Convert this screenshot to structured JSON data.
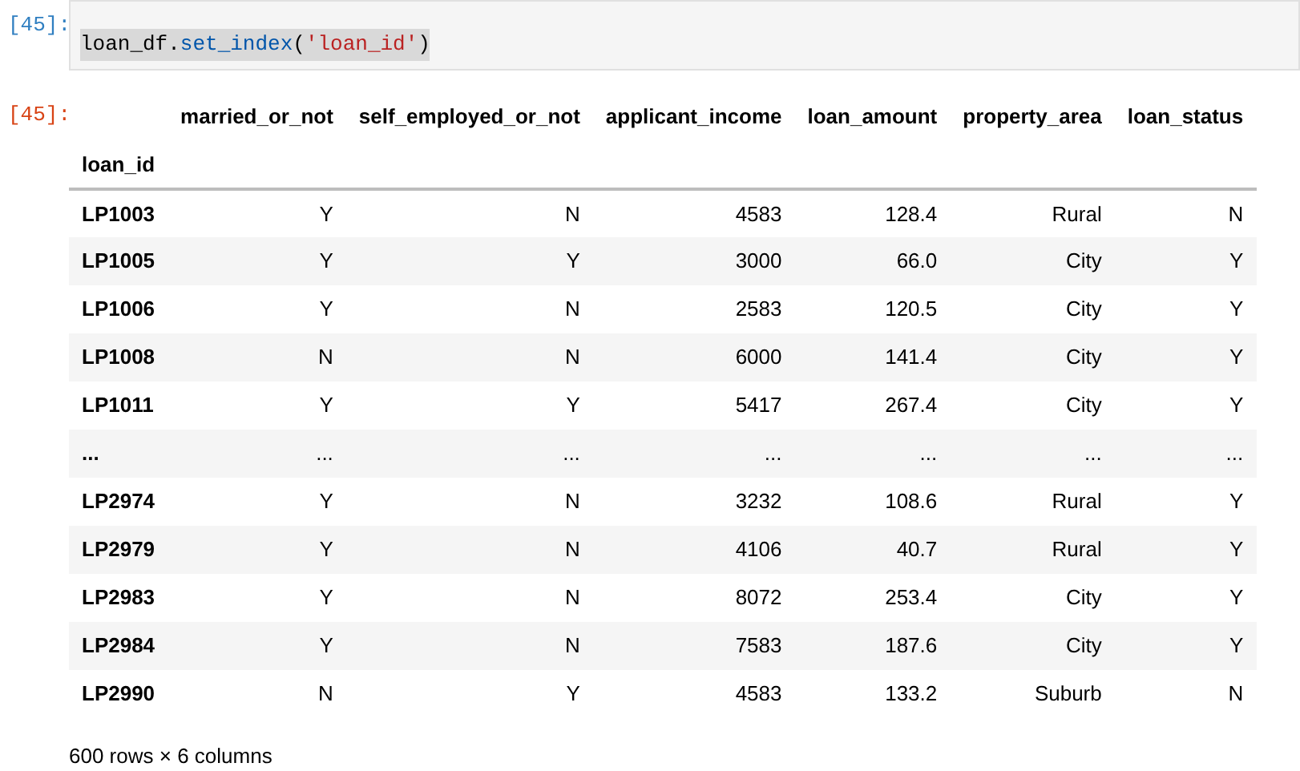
{
  "input_cell": {
    "prompt": "[45]:",
    "code": [
      {
        "kind": "name",
        "text": "loan_df"
      },
      {
        "kind": "punct",
        "text": "."
      },
      {
        "kind": "method",
        "text": "set_index"
      },
      {
        "kind": "punct",
        "text": "("
      },
      {
        "kind": "string",
        "text": "'loan_id'"
      },
      {
        "kind": "punct",
        "text": ")"
      }
    ]
  },
  "output_cell": {
    "prompt": "[45]:",
    "table": {
      "index_name": "loan_id",
      "columns": [
        "married_or_not",
        "self_employed_or_not",
        "applicant_income",
        "loan_amount",
        "property_area",
        "loan_status"
      ],
      "rows": [
        {
          "index": "LP1003",
          "cells": [
            "Y",
            "N",
            "4583",
            "128.4",
            "Rural",
            "N"
          ]
        },
        {
          "index": "LP1005",
          "cells": [
            "Y",
            "Y",
            "3000",
            "66.0",
            "City",
            "Y"
          ]
        },
        {
          "index": "LP1006",
          "cells": [
            "Y",
            "N",
            "2583",
            "120.5",
            "City",
            "Y"
          ]
        },
        {
          "index": "LP1008",
          "cells": [
            "N",
            "N",
            "6000",
            "141.4",
            "City",
            "Y"
          ]
        },
        {
          "index": "LP1011",
          "cells": [
            "Y",
            "Y",
            "5417",
            "267.4",
            "City",
            "Y"
          ]
        },
        {
          "index": "...",
          "cells": [
            "...",
            "...",
            "...",
            "...",
            "...",
            "..."
          ]
        },
        {
          "index": "LP2974",
          "cells": [
            "Y",
            "N",
            "3232",
            "108.6",
            "Rural",
            "Y"
          ]
        },
        {
          "index": "LP2979",
          "cells": [
            "Y",
            "N",
            "4106",
            "40.7",
            "Rural",
            "Y"
          ]
        },
        {
          "index": "LP2983",
          "cells": [
            "Y",
            "N",
            "8072",
            "253.4",
            "City",
            "Y"
          ]
        },
        {
          "index": "LP2984",
          "cells": [
            "Y",
            "N",
            "7583",
            "187.6",
            "City",
            "Y"
          ]
        },
        {
          "index": "LP2990",
          "cells": [
            "N",
            "Y",
            "4583",
            "133.2",
            "Suburb",
            "N"
          ]
        }
      ]
    },
    "shape": "600 rows × 6 columns"
  }
}
